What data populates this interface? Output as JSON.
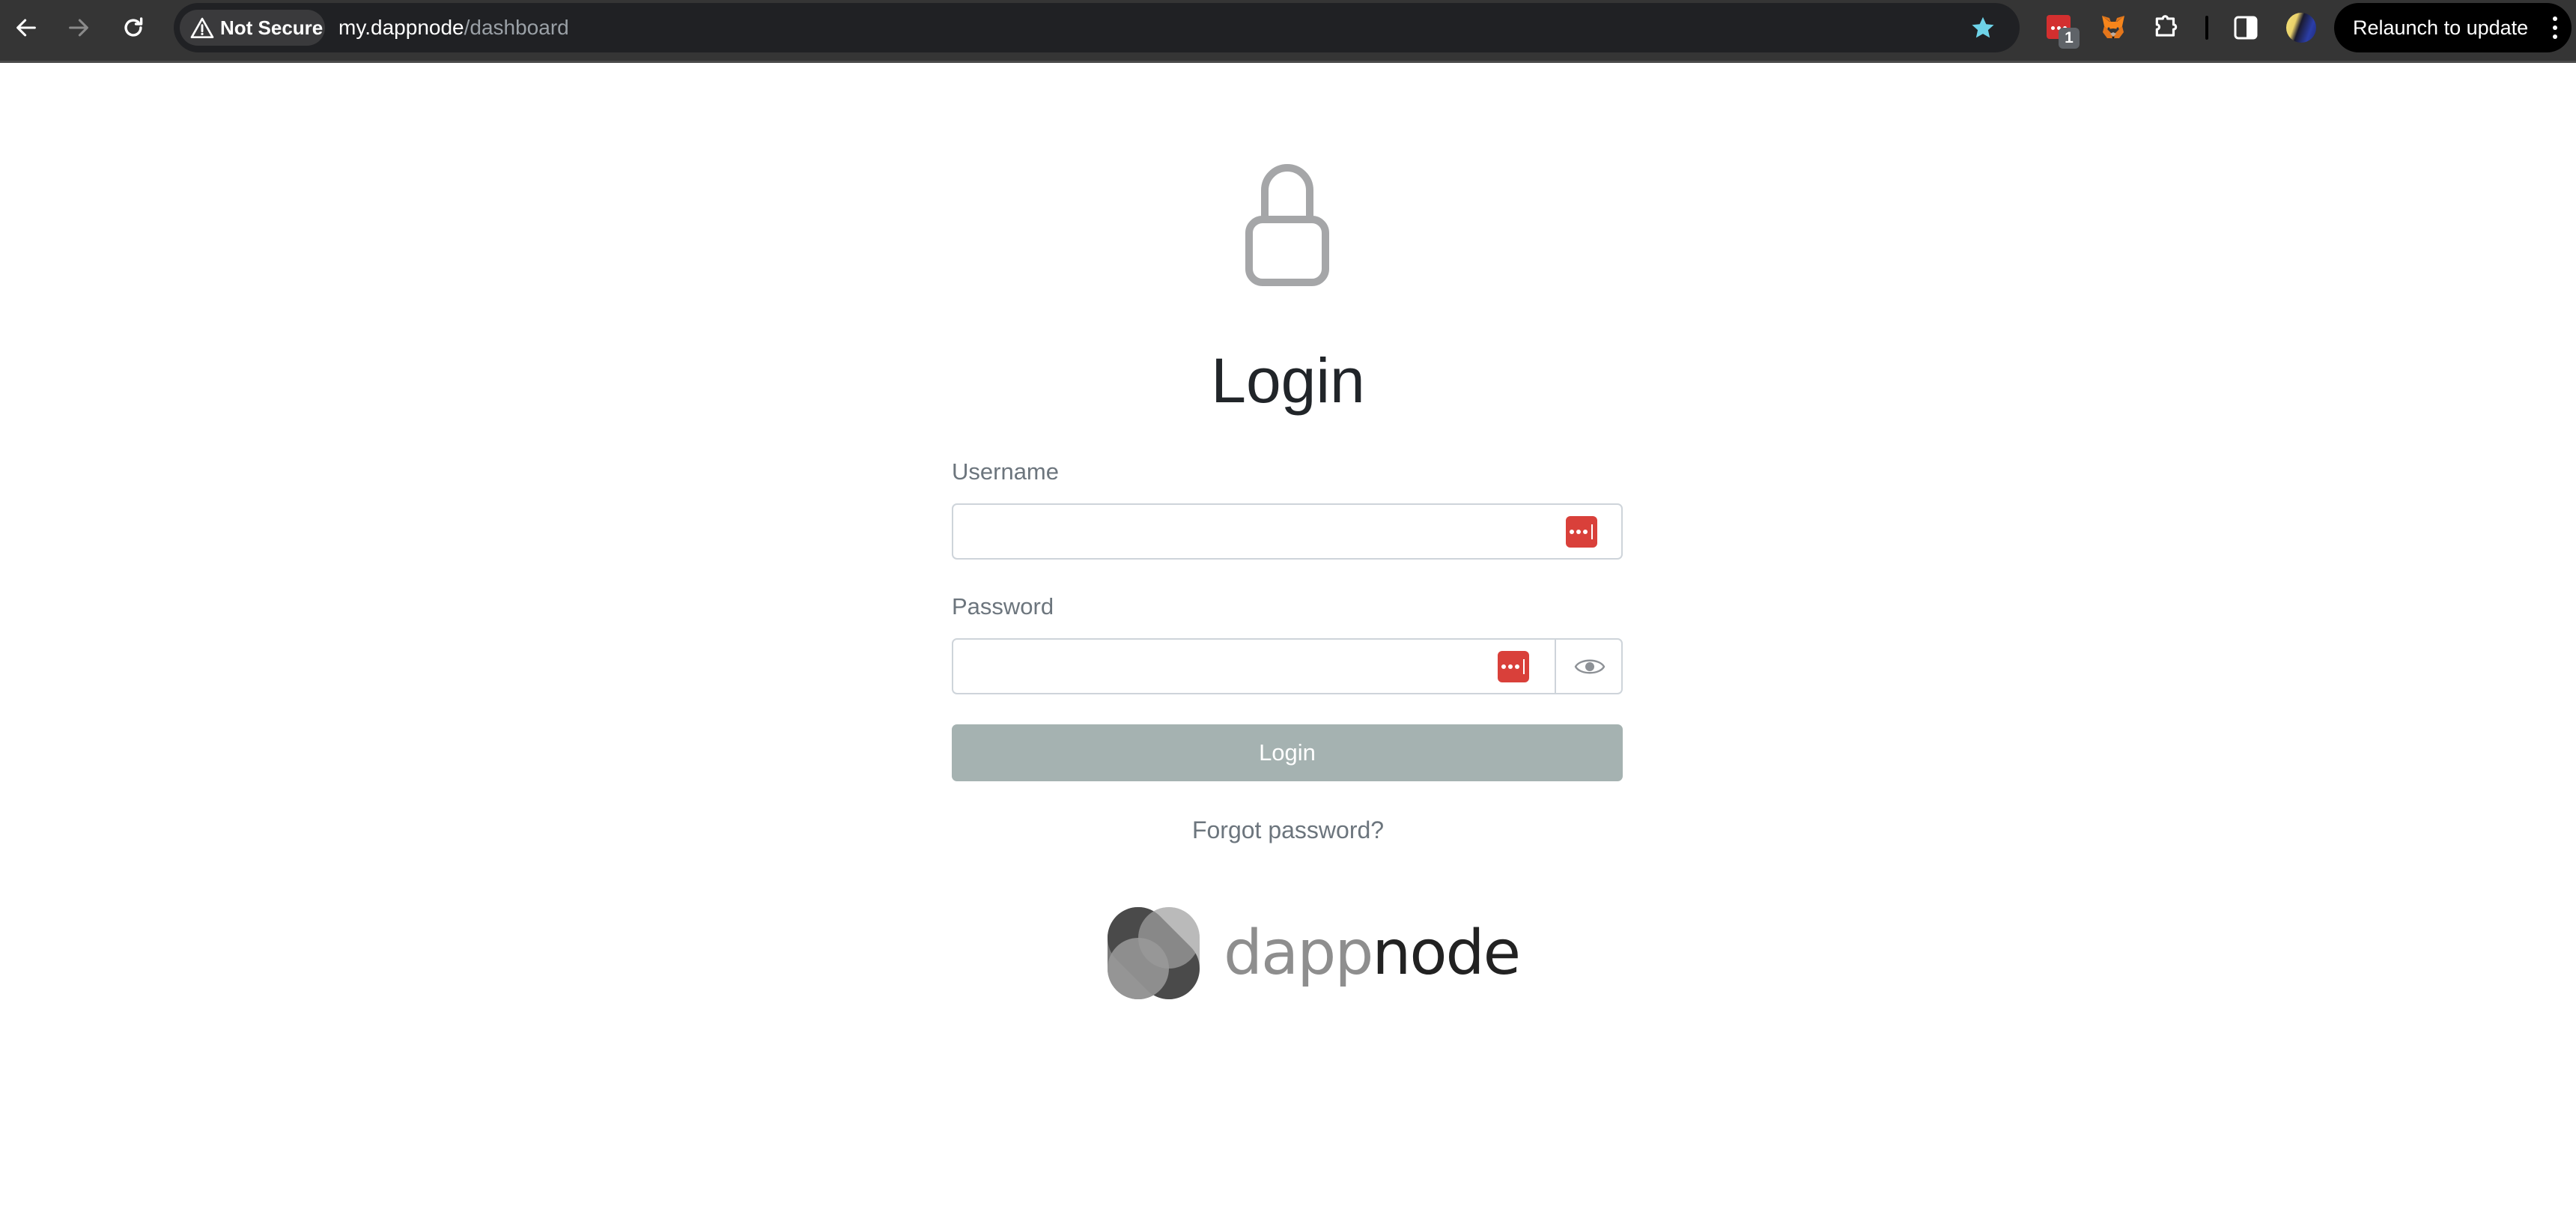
{
  "browser": {
    "security_label": "Not Secure",
    "url_host": "my.dappnode",
    "url_path": "/dashboard",
    "relaunch_label": "Relaunch to update",
    "extensions": [
      {
        "name": "lastpass-extension",
        "badge": "1"
      },
      {
        "name": "metamask-extension"
      }
    ],
    "colors": {
      "toolbar_bg": "#353535",
      "omnibox_bg": "#202124",
      "bookmark_star": "#6ed3e8"
    }
  },
  "page": {
    "lock_icon": "lock-icon",
    "title": "Login",
    "username": {
      "label": "Username",
      "value": "",
      "placeholder": ""
    },
    "password": {
      "label": "Password",
      "value": "",
      "placeholder": "",
      "toggle_icon": "eye-icon"
    },
    "login_button": "Login",
    "forgot_password": "Forgot password?",
    "brand": {
      "word_light": "dapp",
      "word_dark": "node"
    },
    "colors": {
      "title": "#212529",
      "label": "#6c757d",
      "input_border": "#ced4da",
      "button_bg": "#a5b2b1",
      "lastpass_red": "#d9403a"
    }
  }
}
